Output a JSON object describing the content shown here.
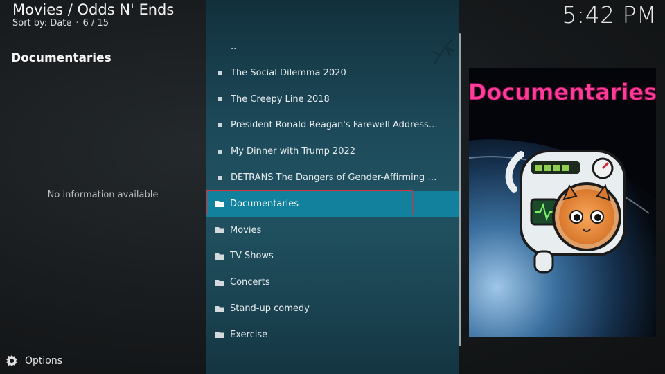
{
  "header": {
    "title": "Movies / Odds N' Ends",
    "sort_label": "Sort by: Date",
    "separator": "·",
    "position": "6 / 15",
    "clock": "5:42 PM"
  },
  "info": {
    "title": "Documentaries",
    "empty_text": "No information available"
  },
  "list": {
    "items": [
      {
        "label": "..",
        "kind": "parent"
      },
      {
        "label": "The Social Dilemma 2020",
        "kind": "file"
      },
      {
        "label": "The Creepy Line 2018",
        "kind": "file"
      },
      {
        "label": "President Ronald Reagan's Farewell Address to ...",
        "kind": "file"
      },
      {
        "label": "My Dinner with Trump 2022",
        "kind": "file"
      },
      {
        "label": "DETRANS The Dangers of Gender-Affirming Car...",
        "kind": "file"
      },
      {
        "label": "Documentaries",
        "kind": "folder",
        "selected": true
      },
      {
        "label": "Movies",
        "kind": "folder"
      },
      {
        "label": "TV Shows",
        "kind": "folder"
      },
      {
        "label": "Concerts",
        "kind": "folder"
      },
      {
        "label": "Stand-up comedy",
        "kind": "folder"
      },
      {
        "label": "Exercise",
        "kind": "folder"
      }
    ]
  },
  "poster": {
    "title_text": "Documentaries",
    "icon": "cat-astronaut-poster-image"
  },
  "footer": {
    "options_label": "Options",
    "icon": "options-cog-icon"
  },
  "colors": {
    "selection": "#12819d",
    "highlight_border": "#d8323a",
    "poster_title": "#ff3c9a"
  }
}
